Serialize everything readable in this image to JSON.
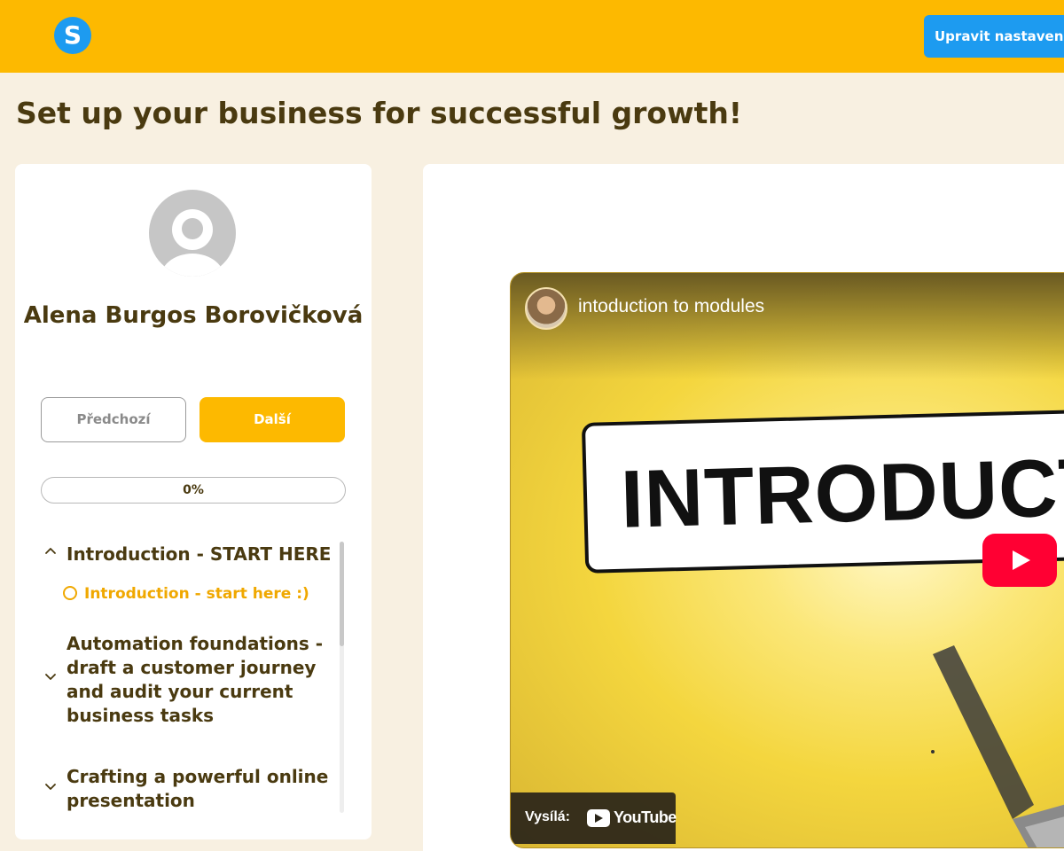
{
  "header": {
    "logo_letter": "S",
    "settings_button": "Upravit nastavení"
  },
  "page": {
    "title": "Set up your business for successful growth!"
  },
  "sidebar": {
    "user_name": "Alena Burgos Borovičková",
    "prev_button": "Předchozí",
    "next_button": "Další",
    "progress_label": "0%",
    "progress_value": 0,
    "modules": [
      {
        "title": "Introduction - START HERE",
        "expanded": true,
        "lessons": [
          {
            "title": "Introduction - start here :)",
            "status": "not-started"
          }
        ]
      },
      {
        "title": "Automation foundations - draft a customer journey and audit your current business tasks",
        "expanded": false
      },
      {
        "title": "Crafting a powerful online presentation",
        "expanded": false
      }
    ]
  },
  "video": {
    "title": "intoduction to modules",
    "thumbnail_text": "INTRODUCTIO",
    "broadcast_label": "Vysílá:",
    "platform": "YouTube"
  },
  "colors": {
    "brand_yellow": "#fdb900",
    "accent_blue": "#1d9bf0",
    "page_background": "#f8f0e1",
    "text_brown": "#4a3a10",
    "lesson_active": "#f0a800",
    "youtube_red": "#ff0033"
  }
}
